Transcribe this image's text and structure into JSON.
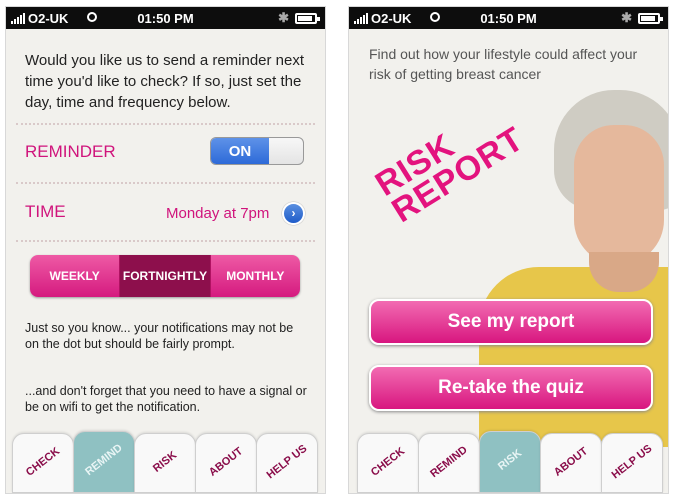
{
  "status": {
    "carrier": "O2-UK",
    "time": "01:50 PM"
  },
  "reminder_screen": {
    "intro": "Would you like us to send a reminder next time you'd like to check? If so, just set the day, time and frequency below.",
    "reminder_label": "REMINDER",
    "toggle_value": "ON",
    "time_label": "TIME",
    "time_value": "Monday at 7pm",
    "frequency": [
      "WEEKLY",
      "FORTNIGHTLY",
      "MONTHLY"
    ],
    "selected_frequency": "FORTNIGHTLY",
    "note1": "Just so you know... your notifications may not be on the dot but should be fairly prompt.",
    "note2": "...and don't forget that you need to have a signal or be on wifi to get the notification."
  },
  "risk_screen": {
    "tagline": "Find out how your lifestyle could affect your risk of getting breast cancer",
    "title_line1": "RISK",
    "title_line2": "REPORT",
    "see_button": "See my report",
    "retake_button": "Re-take the quiz"
  },
  "tabs": [
    "CHECK",
    "REMIND",
    "RISK",
    "ABOUT",
    "HELP US"
  ],
  "colors": {
    "accent": "#d0147c",
    "active_tab": "#8fc1c2",
    "toggle_on": "#2d6ad8"
  }
}
